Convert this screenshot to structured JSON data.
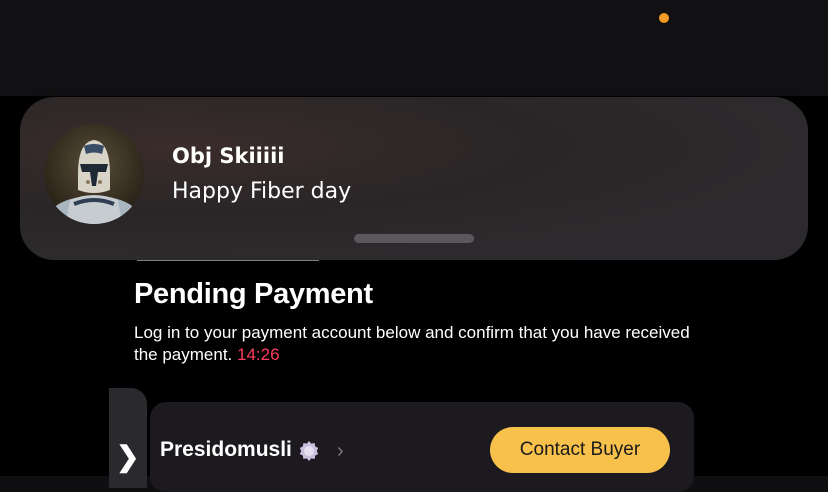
{
  "colors": {
    "status_dot": "#f59a23",
    "timer": "#ff3d5e",
    "contact_button_bg": "#f7c14c"
  },
  "notification": {
    "sender": "Obj Skiiiii",
    "message": "Happy Fiber day",
    "avatar_icon": "helmet-avatar-icon"
  },
  "page": {
    "title": "Pending Payment",
    "description": "Log in to your payment account below and confirm that you have received the payment.",
    "timer": "14:26"
  },
  "buyer": {
    "name": "Presidomusli",
    "verified_icon": "verified-badge-icon",
    "contact_label": "Contact Buyer"
  },
  "drawer": {
    "chevron": "❯"
  },
  "chevron_right": "›"
}
